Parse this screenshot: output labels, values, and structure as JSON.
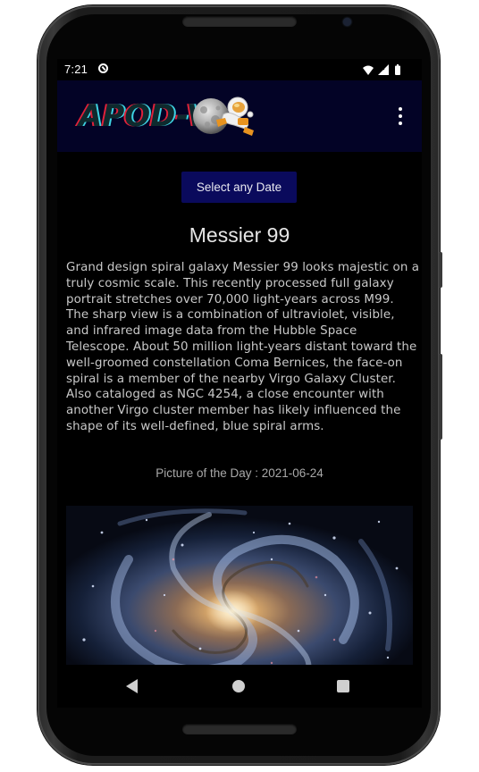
{
  "status_bar": {
    "time": "7:21",
    "notification_icon": "sync-circle-icon",
    "icons": [
      "wifi-icon",
      "cellular-signal-icon",
      "battery-icon"
    ]
  },
  "app_bar": {
    "logo_text": "APOD-V",
    "logo_icons": [
      "moon-icon",
      "astronaut-icon"
    ],
    "menu_icon": "more-vert-icon",
    "background": "#030326"
  },
  "actions": {
    "select_date_label": "Select any Date",
    "button_color": "#0a0a5c"
  },
  "apod": {
    "title": "Messier 99",
    "explanation": "Grand design spiral galaxy Messier 99 looks majestic on a truly cosmic scale. This recently processed full galaxy portrait stretches over 70,000 light-years across M99. The sharp view is a combination of ultraviolet, visible, and infrared image data from the Hubble Space Telescope. About 50 million light-years distant toward the well-groomed constellation Coma Bernices, the face-on spiral is a member of the nearby Virgo Galaxy Cluster. Also cataloged as NGC 4254, a close encounter with another Virgo cluster member has likely influenced the shape of its well-defined, blue spiral arms.",
    "date_caption": "Picture of the Day : 2021-06-24",
    "image_subject": "spiral-galaxy-image"
  },
  "nav_bar": {
    "items": [
      "back-icon",
      "home-icon",
      "recents-icon"
    ]
  }
}
